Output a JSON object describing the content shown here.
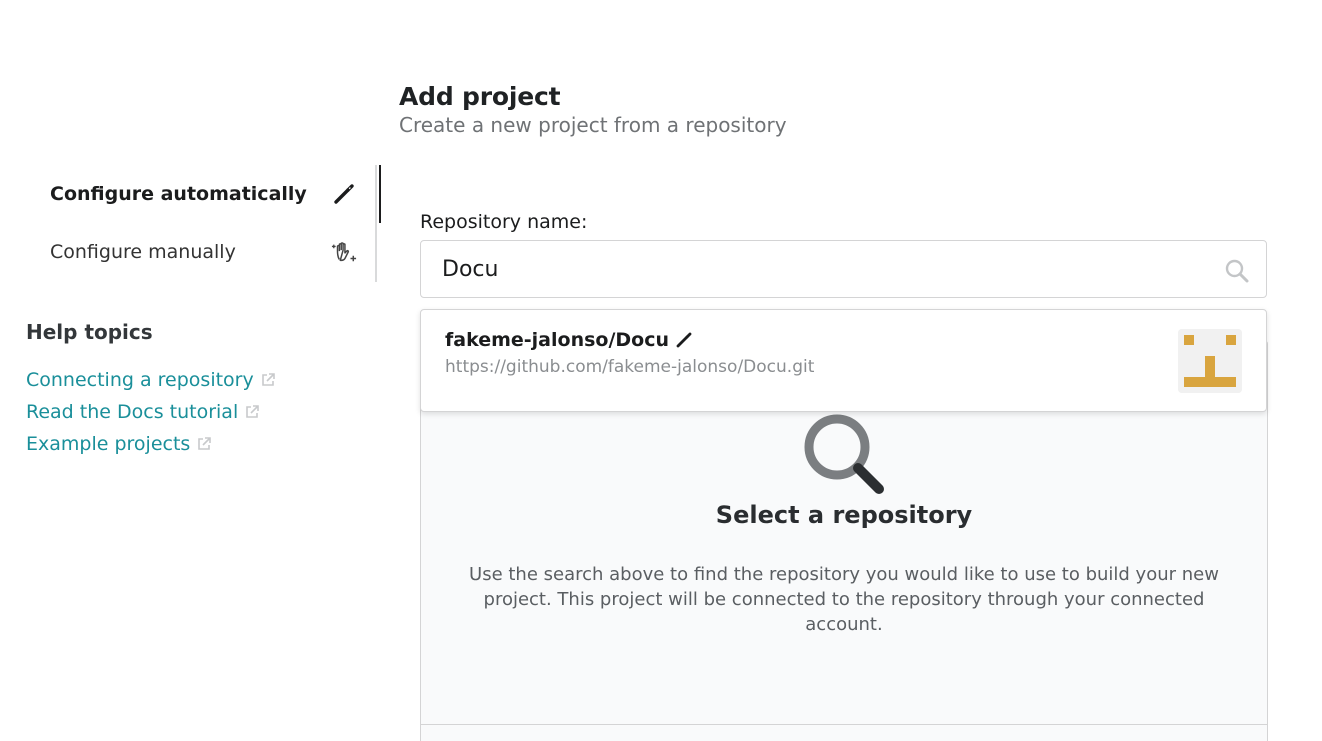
{
  "header": {
    "title": "Add project",
    "subtitle": "Create a new project from a repository"
  },
  "config_menu": {
    "items": [
      {
        "label": "Configure automatically",
        "icon": "magic-wand-icon",
        "active": true
      },
      {
        "label": "Configure manually",
        "icon": "hand-sparkles-icon",
        "active": false
      }
    ]
  },
  "help": {
    "title": "Help topics",
    "links": [
      {
        "label": "Connecting a repository",
        "icon": "external-link-icon"
      },
      {
        "label": "Read the Docs tutorial",
        "icon": "external-link-icon"
      },
      {
        "label": "Example projects",
        "icon": "external-link-icon"
      }
    ]
  },
  "repository": {
    "label": "Repository name:",
    "value": "Docu",
    "search_icon": "search-icon"
  },
  "result": {
    "name": "fakeme-jalonso/Docu",
    "url": "https://github.com/fakeme-jalonso/Docu.git",
    "avatar_color": "#d9a53f"
  },
  "placeholder": {
    "title": "Select a repository",
    "text": "Use the search above to find the repository you would like to use to build your new project. This project will be connected to the repository through your connected account."
  },
  "colors": {
    "link": "#1a8f9a",
    "text": "#1b1c1d",
    "muted": "#6f7275"
  }
}
